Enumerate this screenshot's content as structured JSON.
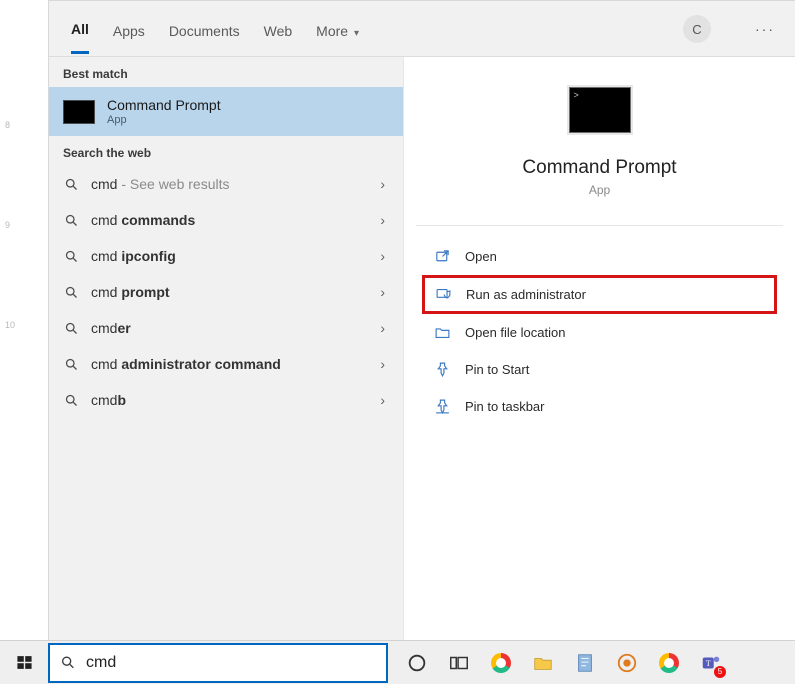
{
  "tabs": {
    "all": "All",
    "apps": "Apps",
    "documents": "Documents",
    "web": "Web",
    "more": "More"
  },
  "avatar_letter": "C",
  "section_best_match": "Best match",
  "best_match": {
    "title": "Command Prompt",
    "subtitle": "App"
  },
  "section_web": "Search the web",
  "web_results": [
    {
      "prefix": "cmd",
      "suffix": "",
      "tail": " - See web results",
      "tail_light": true
    },
    {
      "prefix": "cmd ",
      "suffix": "commands",
      "tail": "",
      "tail_light": false
    },
    {
      "prefix": "cmd ",
      "suffix": "ipconfig",
      "tail": "",
      "tail_light": false
    },
    {
      "prefix": "cmd ",
      "suffix": "prompt",
      "tail": "",
      "tail_light": false
    },
    {
      "prefix": "cmd",
      "suffix": "er",
      "tail": "",
      "tail_light": false
    },
    {
      "prefix": "cmd ",
      "suffix": "administrator command",
      "tail": "",
      "tail_light": false
    },
    {
      "prefix": "cmd",
      "suffix": "b",
      "tail": "",
      "tail_light": false
    }
  ],
  "preview": {
    "title": "Command Prompt",
    "subtitle": "App"
  },
  "actions": {
    "open": "Open",
    "run_admin": "Run as administrator",
    "open_location": "Open file location",
    "pin_start": "Pin to Start",
    "pin_taskbar": "Pin to taskbar"
  },
  "search_value": "cmd",
  "ruler_marks": [
    "8",
    "9",
    "10"
  ]
}
